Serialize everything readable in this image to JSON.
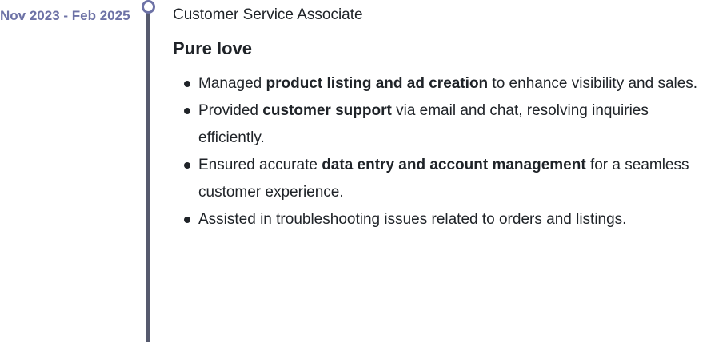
{
  "entry": {
    "date": "Nov 2023 - Feb 2025",
    "role": "Customer Service Associate",
    "company": "Pure love",
    "bullets": [
      {
        "pre": "Managed ",
        "bold": "product listing and ad creation",
        "post": " to enhance visibility and sales."
      },
      {
        "pre": "Provided ",
        "bold": "customer support",
        "post": " via email and chat, resolving inquiries efficiently."
      },
      {
        "pre": "Ensured accurate ",
        "bold": "data entry and account management",
        "post": " for a seamless customer experience."
      },
      {
        "pre": "Assisted in troubleshooting issues related to orders and listings.",
        "bold": "",
        "post": ""
      }
    ]
  },
  "colors": {
    "accent": "#6d72a6",
    "timeline": "#565a6e",
    "text": "#1f2328"
  }
}
